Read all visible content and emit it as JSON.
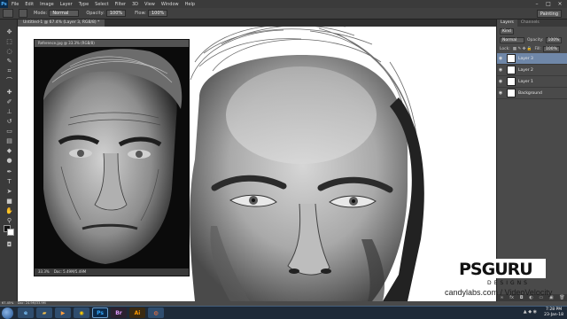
{
  "app": {
    "logo": "Ps"
  },
  "menubar": {
    "items": [
      "File",
      "Edit",
      "Image",
      "Layer",
      "Type",
      "Select",
      "Filter",
      "3D",
      "View",
      "Window",
      "Help"
    ],
    "window_controls": [
      "–",
      "□",
      "×"
    ]
  },
  "optionsbar": {
    "mode_label": "Mode:",
    "mode_value": "Normal",
    "opacity_label": "Opacity:",
    "opacity_value": "100%",
    "flow_label": "Flow:",
    "flow_value": "100%",
    "workspace": "Painting"
  },
  "document": {
    "tab_label": "Untitled-1 @ 67.4% (Layer 3, RGB/8) *"
  },
  "reference_window": {
    "title": "Reference.jpg @ 33.3% (RGB/8)",
    "zoom": "33.3%",
    "doc_size": "Doc: 5.49M/5.49M"
  },
  "layers_panel": {
    "tabs": [
      "Layers",
      "Channels"
    ],
    "filter_label": "Kind",
    "blend_mode": "Normal",
    "opacity_label": "Opacity:",
    "opacity_value": "100%",
    "lock_label": "Lock:",
    "fill_label": "Fill:",
    "fill_value": "100%",
    "layers": [
      {
        "name": "Layer 3",
        "selected": true
      },
      {
        "name": "Layer 2",
        "selected": false
      },
      {
        "name": "Layer 1",
        "selected": false
      },
      {
        "name": "Background",
        "selected": false
      }
    ]
  },
  "statusbar": {
    "zoom": "67.45%",
    "doc_size": "Doc: 24.9M/33.9M"
  },
  "taskbar": {
    "apps": [
      "IE",
      "Folder",
      "Media",
      "Chrome",
      "Ps",
      "Br",
      "Ai",
      "Firefox"
    ],
    "time": "7:28 PM",
    "date": "23-Jan-18"
  },
  "watermark": {
    "logo_text": "PSGURU",
    "logo_sub": "DESIGNS",
    "url": "candylabs.com / VideoVelocity"
  },
  "colors": {
    "foreground": "#111111",
    "background": "#ffffff",
    "selected_layer": "#6f87a8"
  }
}
